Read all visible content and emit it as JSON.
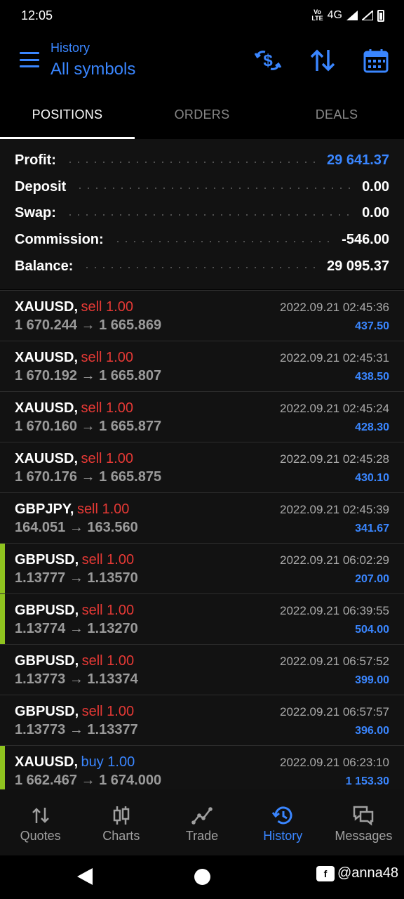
{
  "status": {
    "time": "12:05",
    "volte": "Vo\nLTE",
    "network": "4G"
  },
  "header": {
    "subtitle": "History",
    "title": "All symbols"
  },
  "tabs": [
    {
      "label": "POSITIONS",
      "active": true
    },
    {
      "label": "ORDERS",
      "active": false
    },
    {
      "label": "DEALS",
      "active": false
    }
  ],
  "summary": {
    "profit_label": "Profit:",
    "profit_value": "29 641.37",
    "deposit_label": "Deposit",
    "deposit_value": "0.00",
    "swap_label": "Swap:",
    "swap_value": "0.00",
    "commission_label": "Commission:",
    "commission_value": "-546.00",
    "balance_label": "Balance:",
    "balance_value": "29 095.37"
  },
  "deals": [
    {
      "symbol": "XAUUSD,",
      "side": "sell 1.00",
      "type": "sell",
      "time": "2022.09.21 02:45:36",
      "prices": "1 670.244 → 1 665.869",
      "profit": "437.50",
      "marker": false
    },
    {
      "symbol": "XAUUSD,",
      "side": "sell 1.00",
      "type": "sell",
      "time": "2022.09.21 02:45:31",
      "prices": "1 670.192 → 1 665.807",
      "profit": "438.50",
      "marker": false
    },
    {
      "symbol": "XAUUSD,",
      "side": "sell 1.00",
      "type": "sell",
      "time": "2022.09.21 02:45:24",
      "prices": "1 670.160 → 1 665.877",
      "profit": "428.30",
      "marker": false
    },
    {
      "symbol": "XAUUSD,",
      "side": "sell 1.00",
      "type": "sell",
      "time": "2022.09.21 02:45:28",
      "prices": "1 670.176 → 1 665.875",
      "profit": "430.10",
      "marker": false
    },
    {
      "symbol": "GBPJPY,",
      "side": "sell 1.00",
      "type": "sell",
      "time": "2022.09.21 02:45:39",
      "prices": "164.051 → 163.560",
      "profit": "341.67",
      "marker": false
    },
    {
      "symbol": "GBPUSD,",
      "side": "sell 1.00",
      "type": "sell",
      "time": "2022.09.21 06:02:29",
      "prices": "1.13777 → 1.13570",
      "profit": "207.00",
      "marker": true
    },
    {
      "symbol": "GBPUSD,",
      "side": "sell 1.00",
      "type": "sell",
      "time": "2022.09.21 06:39:55",
      "prices": "1.13774 → 1.13270",
      "profit": "504.00",
      "marker": true
    },
    {
      "symbol": "GBPUSD,",
      "side": "sell 1.00",
      "type": "sell",
      "time": "2022.09.21 06:57:52",
      "prices": "1.13773 → 1.13374",
      "profit": "399.00",
      "marker": false
    },
    {
      "symbol": "GBPUSD,",
      "side": "sell 1.00",
      "type": "sell",
      "time": "2022.09.21 06:57:57",
      "prices": "1.13773 → 1.13377",
      "profit": "396.00",
      "marker": false
    },
    {
      "symbol": "XAUUSD,",
      "side": "buy 1.00",
      "type": "buy",
      "time": "2022.09.21 06:23:10",
      "prices": "1 662.467 → 1 674.000",
      "profit": "1 153.30",
      "marker": true
    }
  ],
  "nav": [
    {
      "label": "Quotes",
      "icon": "quotes-icon",
      "active": false
    },
    {
      "label": "Charts",
      "icon": "charts-icon",
      "active": false
    },
    {
      "label": "Trade",
      "icon": "trade-icon",
      "active": false
    },
    {
      "label": "History",
      "icon": "history-icon",
      "active": true
    },
    {
      "label": "Messages",
      "icon": "messages-icon",
      "active": false
    }
  ],
  "watermark": "@anna48",
  "colors": {
    "accent": "#3a86ff",
    "sell": "#e53935",
    "marker": "#8fc31f"
  }
}
